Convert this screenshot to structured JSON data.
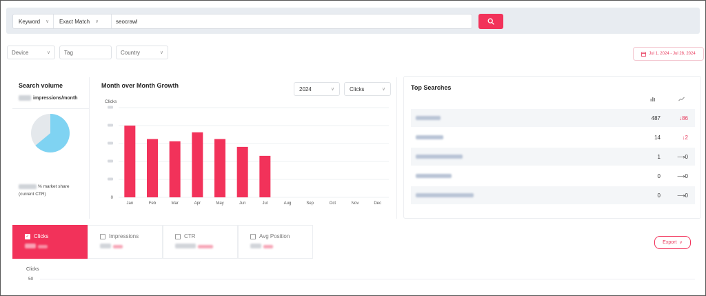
{
  "search": {
    "type_label": "Keyword",
    "match_label": "Exact Match",
    "query": "seocrawl"
  },
  "filters": {
    "device": "Device",
    "tag": "Tag",
    "country": "Country",
    "date_range": "Jul 1, 2024 - Jul 28, 2024"
  },
  "search_volume": {
    "title": "Search volume",
    "unit": "impressions/month",
    "market_share_suffix": "% market share",
    "ctr_note": "(current CTR)",
    "pie_share": 0.64,
    "pie_color": "#7fd3f2",
    "pie_rest_color": "#e4e8ec"
  },
  "mom": {
    "title": "Month over Month Growth",
    "year": "2024",
    "metric": "Clicks"
  },
  "chart_data": {
    "type": "bar",
    "ylabel": "Clicks",
    "categories": [
      "Jan",
      "Feb",
      "Mar",
      "Apr",
      "May",
      "Jun",
      "Jul",
      "Aug",
      "Sep",
      "Oct",
      "Nov",
      "Dec"
    ],
    "values": [
      3.2,
      2.6,
      2.5,
      2.9,
      2.6,
      2.25,
      1.85,
      0,
      0,
      0,
      0,
      0
    ],
    "y_ticks": [
      "0",
      "",
      "",
      "",
      "",
      ""
    ],
    "ylim": [
      0,
      4
    ],
    "bar_color": "#f2325a",
    "grid": true
  },
  "top_searches": {
    "title": "Top Searches",
    "icon_left": "bar-chart-icon",
    "icon_right": "trend-icon",
    "rows": [
      {
        "value": "487",
        "change": "86",
        "direction": "down"
      },
      {
        "value": "14",
        "change": "2",
        "direction": "down"
      },
      {
        "value": "1",
        "change": "0",
        "direction": "flat"
      },
      {
        "value": "0",
        "change": "0",
        "direction": "flat"
      },
      {
        "value": "0",
        "change": "0",
        "direction": "flat"
      }
    ]
  },
  "tabs": [
    {
      "label": "Clicks",
      "checked": true
    },
    {
      "label": "Impressions",
      "checked": false
    },
    {
      "label": "CTR",
      "checked": false
    },
    {
      "label": "Avg Position",
      "checked": false
    }
  ],
  "export_label": "Export",
  "bottom_chart": {
    "ylabel": "Clicks",
    "tick": "50"
  },
  "colors": {
    "accent": "#f2325a",
    "down": "#e83a5c"
  }
}
